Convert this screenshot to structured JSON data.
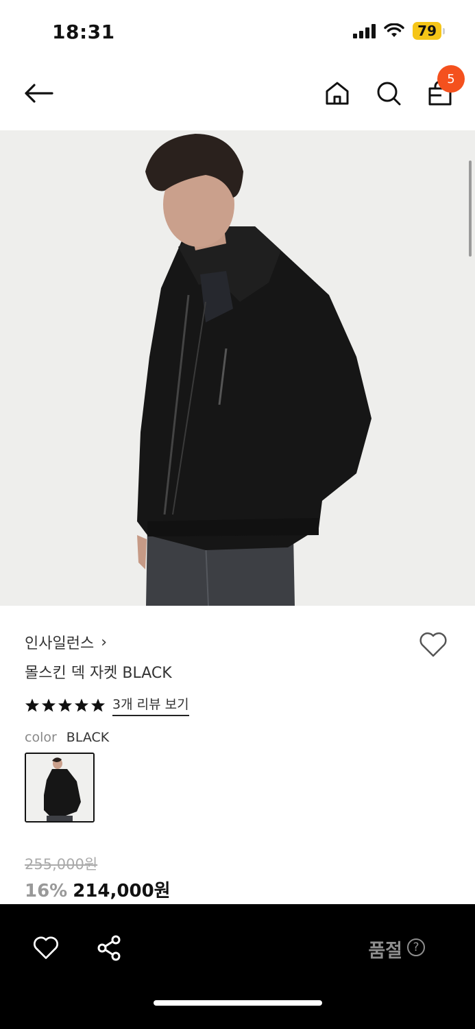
{
  "status_bar": {
    "time": "18:31",
    "battery": "79"
  },
  "top_nav": {
    "cart_count": "5"
  },
  "product": {
    "brand": "인사일런스",
    "brand_chevron": "›",
    "name": "몰스킨 덱 자켓 BLACK",
    "rating_stars": 5,
    "review_link": "3개 리뷰 보기",
    "color_label": "color",
    "color_value": "BLACK",
    "original_price": "255,000원",
    "discount": "16%",
    "sale_price": "214,000원"
  },
  "bottom_bar": {
    "status_label": "품절",
    "help_glyph": "?"
  },
  "icons": {
    "back": "arrow-left-icon",
    "home": "home-icon",
    "search": "search-icon",
    "cart": "shopping-bag-icon",
    "wishlist": "heart-icon",
    "share": "share-icon",
    "help": "question-circle-icon"
  },
  "colors": {
    "badge": "#f4511e",
    "bottom_bar": "#000000",
    "battery": "#f5c518"
  }
}
